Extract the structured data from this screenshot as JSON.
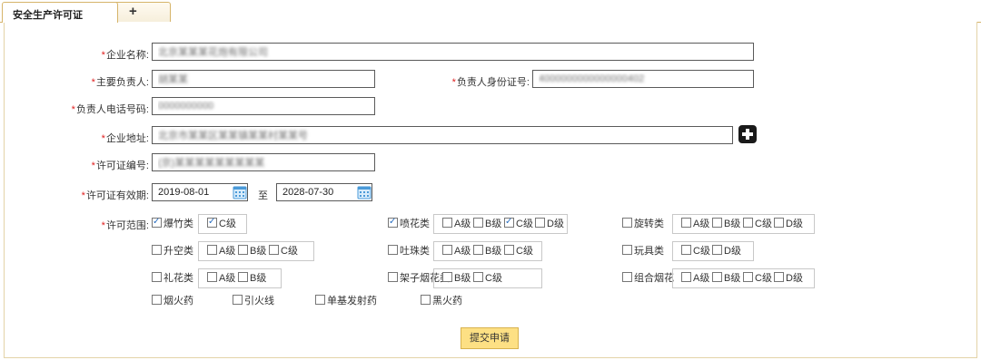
{
  "tabs": {
    "active_label": "安全生产许可证",
    "add_label": "+"
  },
  "form": {
    "company_name": {
      "label": "企业名称:",
      "value": "北京某某某花炮有限公司"
    },
    "principal": {
      "label": "主要负责人:",
      "value": "胡某某"
    },
    "id_number": {
      "label": "负责人身份证号:",
      "value": "4000000000000000402"
    },
    "phone": {
      "label": "负责人电话号码:",
      "value": "0000000000"
    },
    "address": {
      "label": "企业地址:",
      "value": "北京市某某区某某镇某某村某某号"
    },
    "license_no": {
      "label": "许可证编号:",
      "value": "(京)某某某某某某某某某"
    },
    "validity": {
      "label": "许可证有效期:",
      "start": "2019-08-01",
      "separator": "至",
      "end": "2028-07-30"
    },
    "scope": {
      "label": "许可范围:",
      "rows": [
        [
          {
            "name": "爆竹类",
            "checked": true,
            "grades": [
              {
                "g": "C级",
                "checked": true
              }
            ]
          },
          {
            "name": "喷花类",
            "checked": true,
            "grades": [
              {
                "g": "A级",
                "checked": false
              },
              {
                "g": "B级",
                "checked": false
              },
              {
                "g": "C级",
                "checked": true
              },
              {
                "g": "D级",
                "checked": false
              }
            ]
          },
          {
            "name": "旋转类",
            "checked": false,
            "grades": [
              {
                "g": "A级",
                "checked": false
              },
              {
                "g": "B级",
                "checked": false
              },
              {
                "g": "C级",
                "checked": false
              },
              {
                "g": "D级",
                "checked": false
              }
            ]
          }
        ],
        [
          {
            "name": "升空类",
            "checked": false,
            "grades": [
              {
                "g": "A级",
                "checked": false
              },
              {
                "g": "B级",
                "checked": false
              },
              {
                "g": "C级",
                "checked": false
              }
            ]
          },
          {
            "name": "吐珠类",
            "checked": false,
            "grades": [
              {
                "g": "A级",
                "checked": false
              },
              {
                "g": "B级",
                "checked": false
              },
              {
                "g": "C级",
                "checked": false
              }
            ]
          },
          {
            "name": "玩具类",
            "checked": false,
            "grades": [
              {
                "g": "C级",
                "checked": false
              },
              {
                "g": "D级",
                "checked": false
              }
            ]
          }
        ],
        [
          {
            "name": "礼花类",
            "checked": false,
            "grades": [
              {
                "g": "A级",
                "checked": false
              },
              {
                "g": "B级",
                "checked": false
              }
            ]
          },
          {
            "name": "架子烟花类",
            "checked": false,
            "grades": [
              {
                "g": "B级",
                "checked": false
              },
              {
                "g": "C级",
                "checked": false
              }
            ]
          },
          {
            "name": "组合烟花",
            "checked": false,
            "grades": [
              {
                "g": "A级",
                "checked": false
              },
              {
                "g": "B级",
                "checked": false
              },
              {
                "g": "C级",
                "checked": false
              },
              {
                "g": "D级",
                "checked": false
              }
            ]
          }
        ]
      ],
      "extras": [
        {
          "name": "烟火药",
          "checked": false
        },
        {
          "name": "引火线",
          "checked": false
        },
        {
          "name": "单基发射药",
          "checked": false
        },
        {
          "name": "黑火药",
          "checked": false
        }
      ]
    }
  },
  "submit_label": "提交申请",
  "icons": {
    "calendar": "calendar-icon",
    "add": "plus-icon"
  },
  "colors": {
    "tab_border": "#d6b46a",
    "submit_bg": "#fde084",
    "required": "#e02020",
    "check": "#2a6ec0"
  }
}
